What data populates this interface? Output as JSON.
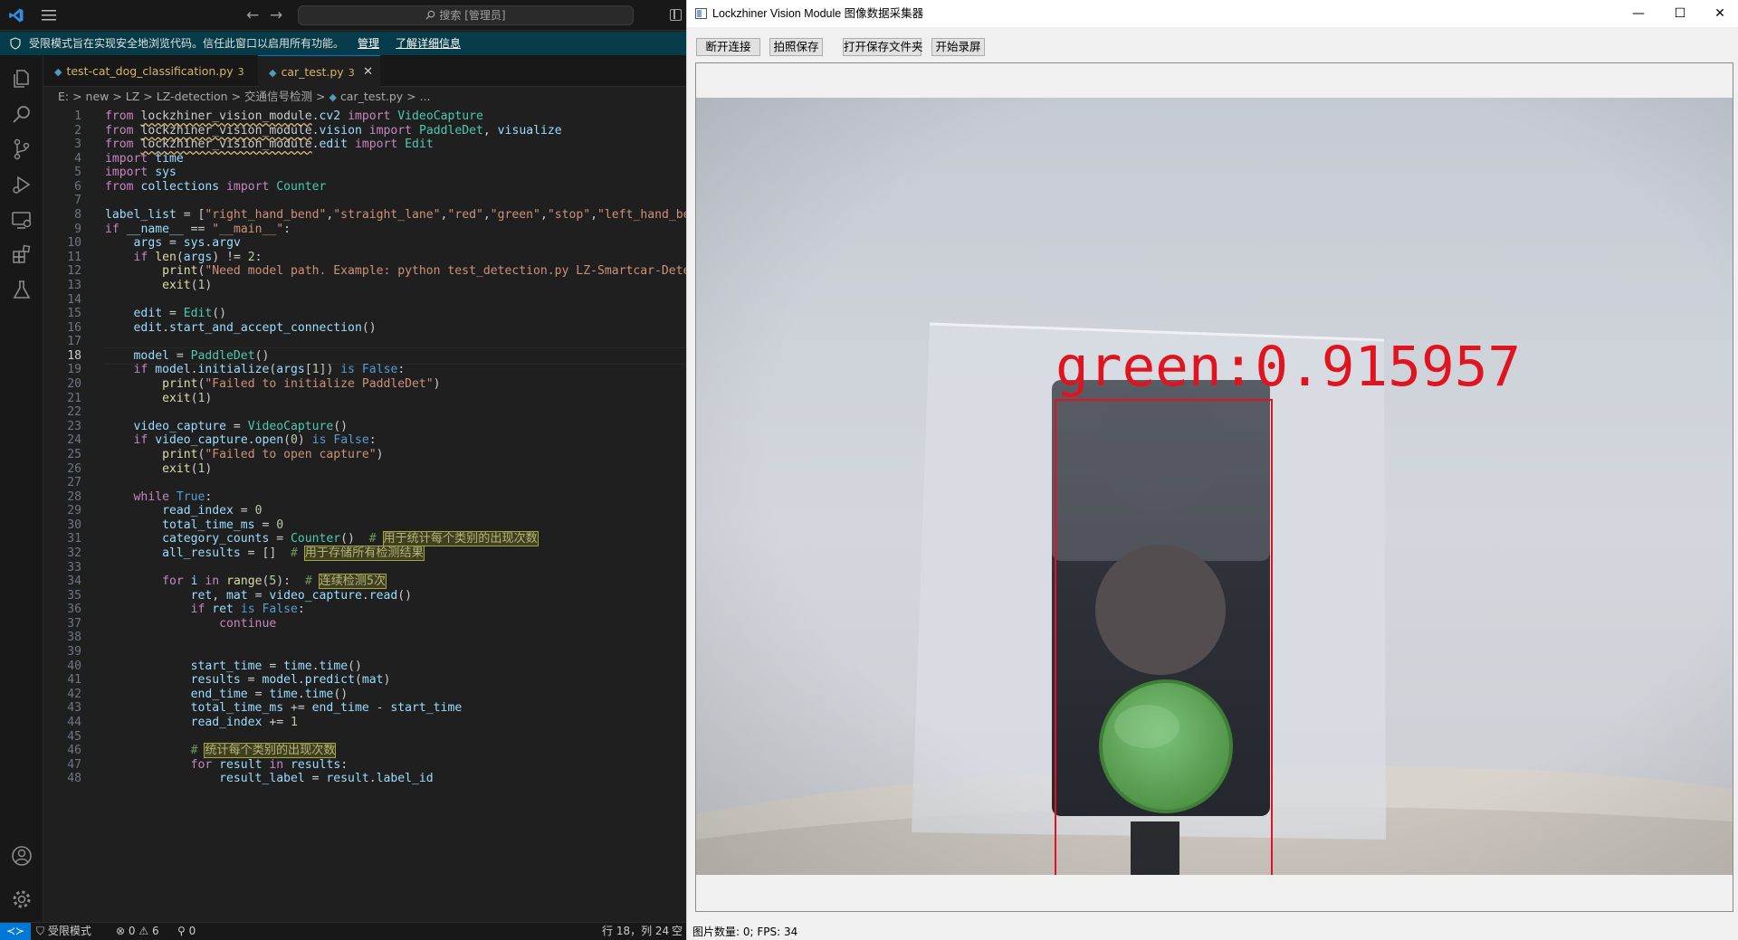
{
  "vscode": {
    "search_text": "搜索 [管理员]",
    "banner": {
      "message": "受限模式旨在实现安全地浏览代码。信任此窗口以启用所有功能。",
      "manage_link": "管理",
      "learn_link": "了解详细信息"
    },
    "tabs": [
      {
        "label": "test-cat_dog_classification.py",
        "count": "3"
      },
      {
        "label": "car_test.py",
        "count": "3"
      }
    ],
    "breadcrumb": [
      "E:",
      "new",
      "LZ",
      "LZ-detection",
      "交通信号检测",
      "car_test.py",
      "..."
    ],
    "status": {
      "mode": "受限模式",
      "errors": "0",
      "warnings": "6",
      "ports": "0",
      "cursor": "行 18，列 24",
      "more": "空"
    }
  },
  "code": {
    "current_line": 18,
    "lines": [
      "from lockzhiner_vision_module.cv2 import VideoCapture",
      "from lockzhiner_vision_module.vision import PaddleDet, visualize",
      "from lockzhiner_vision_module.edit import Edit",
      "import time",
      "import sys",
      "from collections import Counter",
      "",
      "label_list = [\"right_hand_bend\",\"straight_lane\",\"red\",\"green\",\"stop\",\"left_hand_bend",
      "if __name__ == \"__main__\":",
      "    args = sys.argv",
      "    if len(args) != 2:",
      "        print(\"Need model path. Example: python test_detection.py LZ-Smartcar-Detect",
      "        exit(1)",
      "",
      "    edit = Edit()",
      "    edit.start_and_accept_connection()",
      "",
      "    model = PaddleDet()",
      "    if model.initialize(args[1]) is False:",
      "        print(\"Failed to initialize PaddleDet\")",
      "        exit(1)",
      "",
      "    video_capture = VideoCapture()",
      "    if video_capture.open(0) is False:",
      "        print(\"Failed to open capture\")",
      "        exit(1)",
      "",
      "    while True:",
      "        read_index = 0",
      "        total_time_ms = 0",
      "        category_counts = Counter()  # 用于统计每个类别的出现次数",
      "        all_results = []  # 用于存储所有检测结果",
      "",
      "        for i in range(5):  # 连续检测5次",
      "            ret, mat = video_capture.read()",
      "            if ret is False:",
      "                continue",
      "",
      "",
      "            start_time = time.time()",
      "            results = model.predict(mat)",
      "            end_time = time.time()",
      "            total_time_ms += end_time - start_time",
      "            read_index += 1",
      "",
      "            # 统计每个类别的出现次数",
      "            for result in results:",
      "                result_label = result.label_id"
    ]
  },
  "app": {
    "title": "Lockzhiner Vision Module 图像数据采集器",
    "buttons": [
      "断开连接",
      "拍照保存",
      "打开保存文件夹",
      "开始录屏"
    ],
    "detection": {
      "label": "green",
      "score": "0.915957",
      "text": "green:0.915957"
    },
    "status": "图片数量: 0; FPS: 34"
  },
  "colors": {
    "accent": "#0078d4",
    "banner_bg": "#063b49",
    "detection_box": "#e0141e",
    "green_light": "#5e9f52"
  }
}
